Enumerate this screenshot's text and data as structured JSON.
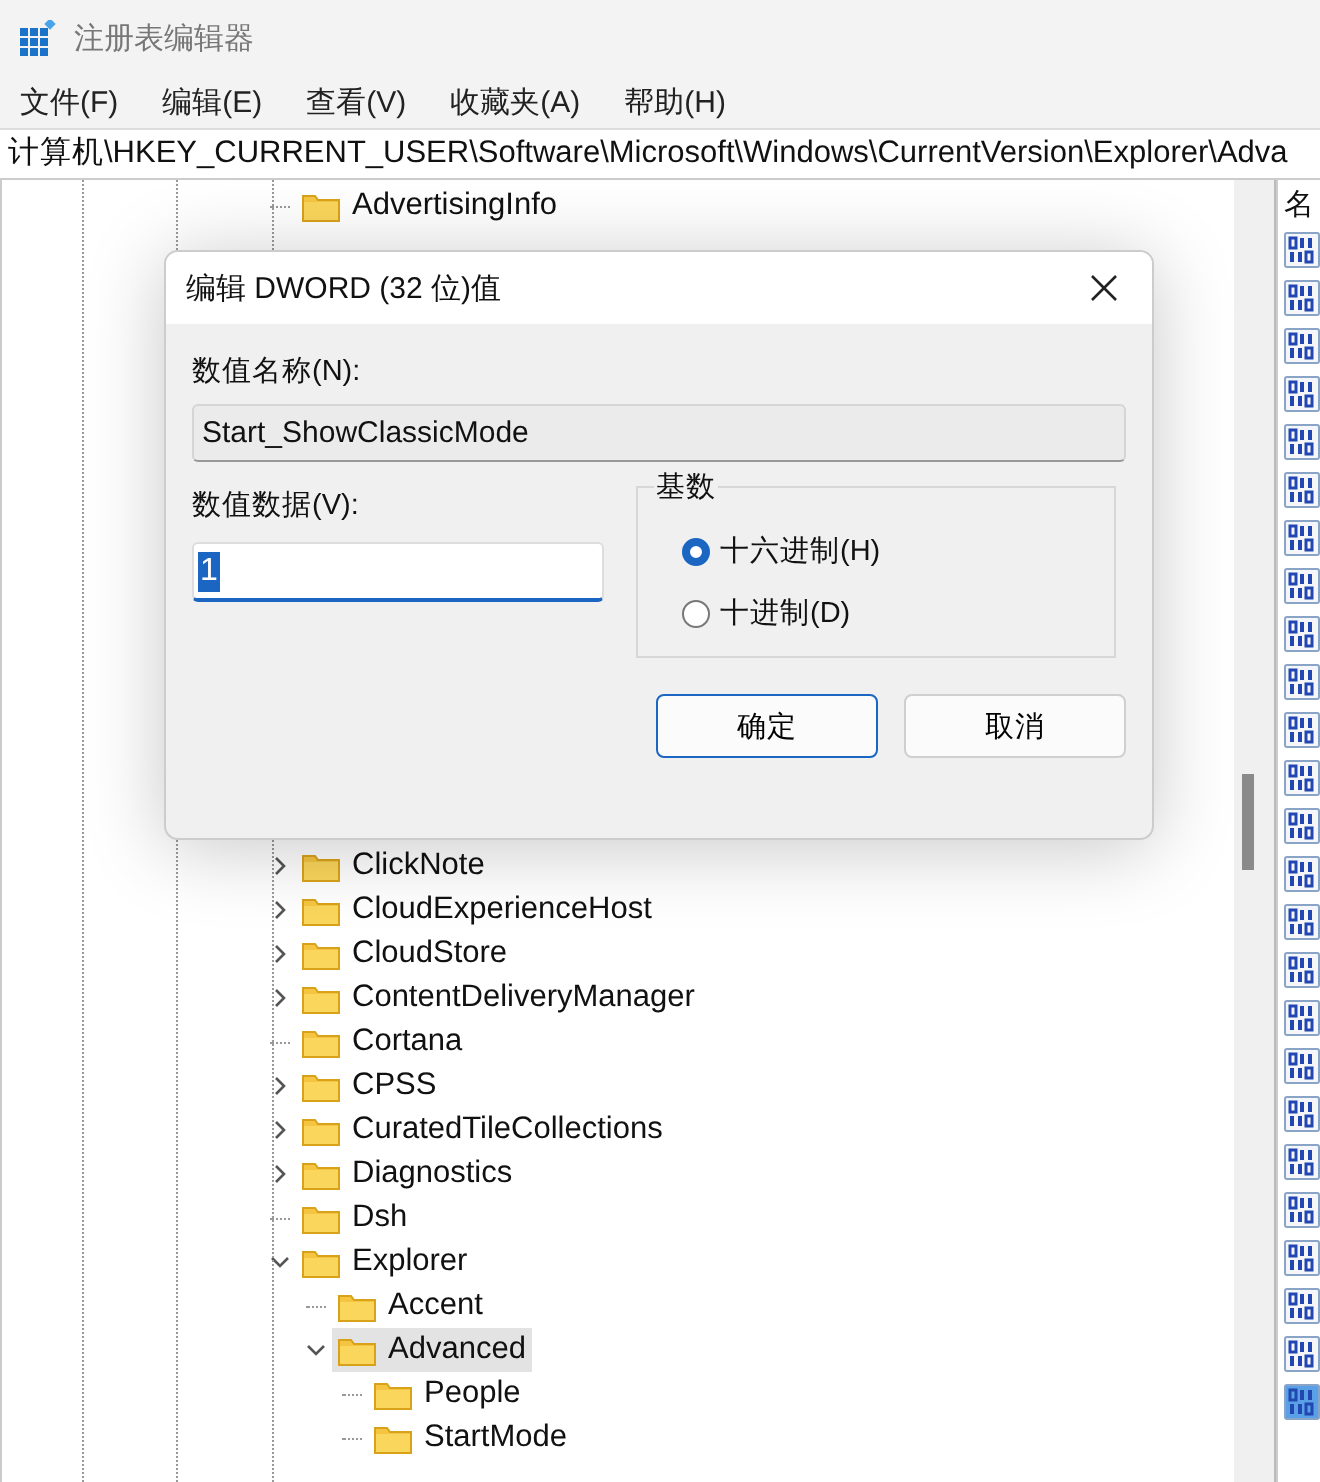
{
  "window": {
    "title": "注册表编辑器"
  },
  "menu": [
    {
      "label": "文件(F)"
    },
    {
      "label": "编辑(E)"
    },
    {
      "label": "查看(V)"
    },
    {
      "label": "收藏夹(A)"
    },
    {
      "label": "帮助(H)"
    }
  ],
  "address": "计算机\\HKEY_CURRENT_USER\\Software\\Microsoft\\Windows\\CurrentVersion\\Explorer\\Adva",
  "tree": [
    {
      "label": "AdvertisingInfo",
      "expandable": false,
      "selected": false
    },
    {
      "label": "ClickNote",
      "expandable": true,
      "expanded": false,
      "selected": false
    },
    {
      "label": "CloudExperienceHost",
      "expandable": true,
      "expanded": false,
      "selected": false
    },
    {
      "label": "CloudStore",
      "expandable": true,
      "expanded": false,
      "selected": false
    },
    {
      "label": "ContentDeliveryManager",
      "expandable": true,
      "expanded": false,
      "selected": false
    },
    {
      "label": "Cortana",
      "expandable": false,
      "selected": false
    },
    {
      "label": "CPSS",
      "expandable": true,
      "expanded": false,
      "selected": false
    },
    {
      "label": "CuratedTileCollections",
      "expandable": true,
      "expanded": false,
      "selected": false
    },
    {
      "label": "Diagnostics",
      "expandable": true,
      "expanded": false,
      "selected": false
    },
    {
      "label": "Dsh",
      "expandable": false,
      "selected": false
    },
    {
      "label": "Explorer",
      "expandable": true,
      "expanded": true,
      "selected": false,
      "children": [
        {
          "label": "Accent",
          "expandable": false,
          "selected": false
        },
        {
          "label": "Advanced",
          "expandable": true,
          "expanded": true,
          "selected": true,
          "children": [
            {
              "label": "People",
              "expandable": false,
              "selected": false
            },
            {
              "label": "StartMode",
              "expandable": false,
              "selected": false
            }
          ]
        }
      ]
    }
  ],
  "values": {
    "column_1": "名",
    "rows": [
      {
        "selected": false
      },
      {
        "selected": false
      },
      {
        "selected": false
      },
      {
        "selected": false
      },
      {
        "selected": false
      },
      {
        "selected": false
      },
      {
        "selected": false
      },
      {
        "selected": false
      },
      {
        "selected": false
      },
      {
        "selected": false
      },
      {
        "selected": false
      },
      {
        "selected": false
      },
      {
        "selected": false
      },
      {
        "selected": false
      },
      {
        "selected": false
      },
      {
        "selected": false
      },
      {
        "selected": false
      },
      {
        "selected": false
      },
      {
        "selected": false
      },
      {
        "selected": false
      },
      {
        "selected": false
      },
      {
        "selected": false
      },
      {
        "selected": false
      },
      {
        "selected": false
      },
      {
        "selected": true
      }
    ]
  },
  "dialog": {
    "title": "编辑 DWORD (32 位)值",
    "name_label": "数值名称(N):",
    "name_value": "Start_ShowClassicMode",
    "data_label": "数值数据(V):",
    "data_value": "1",
    "base_label": "基数",
    "radios": [
      {
        "label": "十六进制(H)",
        "selected": true
      },
      {
        "label": "十进制(D)",
        "selected": false
      }
    ],
    "buttons": [
      {
        "label": "确定",
        "default": true
      },
      {
        "label": "取消",
        "default": false
      }
    ]
  }
}
